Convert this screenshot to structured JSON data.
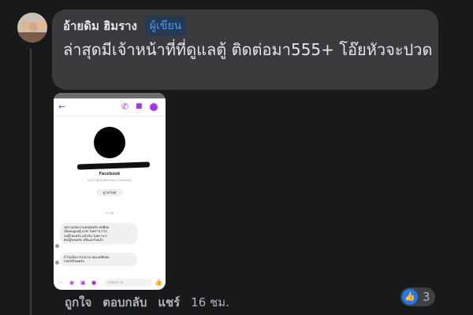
{
  "comment": {
    "author": "อ้ายดิม ฮิมราง",
    "author_badge": "ผู้เขียน",
    "text": "ล่าสุดมีเจ้าหน้าที่ที่ดูแลตู้ ติดต่อมา555+ โอ๊ยหัวจะปวด"
  },
  "screenshot": {
    "platform_label": "Facebook",
    "sub_label": "คุณไม่ได้เป็นเพื่อนกันบน Facebook",
    "profile_button": "ดูโปรไฟล์",
    "time_label": "17:06",
    "messages": [
      "ขบกวนสอบถามหน่อยครับ พอดีผม\nเป็นคนดูแลตู้ ATM ไม่ทราบว่าไป\nกดตู้ไหนครับ แล้วเงิน ไม่ทราบว่า\nยังอยู่ไหนครับ หรือแลกไปแล้ว",
      "ถ้าไม่เป็นการรบกวน ขอแอดติดต่อ\nกลับได้ไหมครับ"
    ],
    "composer_placeholder": "ส่งข้อความ"
  },
  "actions": {
    "like": "ถูกใจ",
    "reply": "ตอบกลับ",
    "share": "แชร์",
    "timestamp": "16 ชม."
  },
  "reactions": {
    "icon": "thumbs-up-icon",
    "count": "3"
  },
  "colors": {
    "background": "#18191a",
    "bubble": "#3a3b3c",
    "badge_text": "#4599ff",
    "messenger_accent": "#a334fa",
    "like_blue": "#2078f4"
  }
}
